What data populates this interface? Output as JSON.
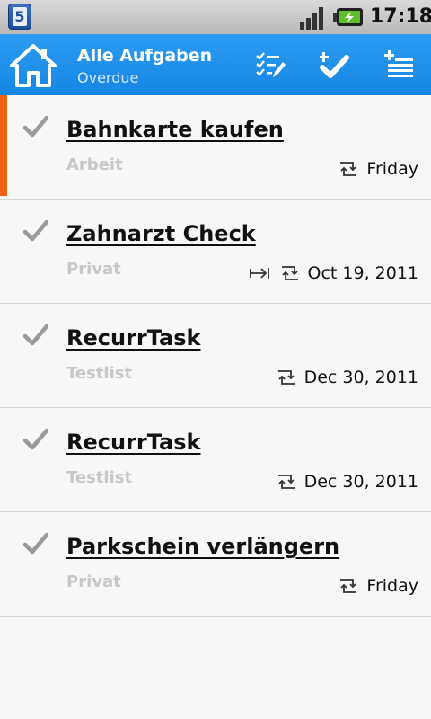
{
  "status_bar": {
    "notification_count": "5",
    "time": "17:18"
  },
  "action_bar": {
    "title": "Alle Aufgaben",
    "subtitle": "Overdue",
    "icons": [
      "home-icon",
      "edit-list-icon",
      "checkmark-plus-icon",
      "add-task-list-icon"
    ],
    "color": "#1e8fea"
  },
  "tasks": [
    {
      "title": "Bahnkarte kaufen",
      "list": "Arbeit",
      "due": "Friday",
      "priority": true,
      "has_start": false
    },
    {
      "title": "Zahnarzt Check",
      "list": "Privat",
      "due": "Oct 19, 2011",
      "priority": false,
      "has_start": true
    },
    {
      "title": "RecurrTask",
      "list": "Testlist",
      "due": "Dec 30, 2011",
      "priority": false,
      "has_start": false
    },
    {
      "title": "RecurrTask",
      "list": "Testlist",
      "due": "Dec 30, 2011",
      "priority": false,
      "has_start": false
    },
    {
      "title": "Parkschein verlängern",
      "list": "Privat",
      "due": "Friday",
      "priority": false,
      "has_start": false
    }
  ],
  "colors": {
    "priority_bar": "#ee6312",
    "list_name": "#c8c8c8",
    "check": "#9a9a9a"
  }
}
